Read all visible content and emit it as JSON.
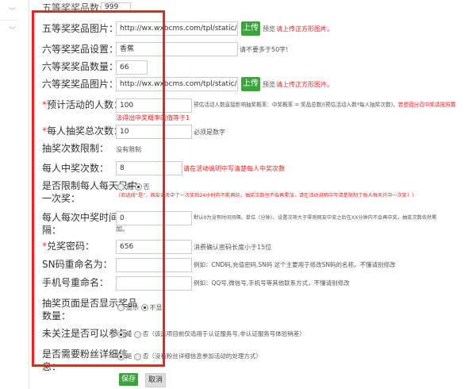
{
  "sidebar": {
    "items": [
      "chevron-down",
      "chevron-down"
    ]
  },
  "form": {
    "r0": {
      "label": "五等奖奖品数量：",
      "value": "999"
    },
    "r1": {
      "label": "五等奖奖品图片：",
      "value": "http://wx.wxbcms.com/tpl/static/attachment",
      "upload": "上传",
      "preview": "预览",
      "note": "请上传正方形图片。"
    },
    "r2": {
      "label": "六等奖奖品设置：",
      "value": "香蕉",
      "hint": "请不要多于50字!"
    },
    "r3": {
      "label": "六等奖奖品数量：",
      "value": "66"
    },
    "r4": {
      "label": "六等奖奖品图片：",
      "value": "http://wx.wxbcms.com/tpl/static/attachment",
      "upload": "上传",
      "preview": "预览",
      "note": "请上传正方形图片。"
    },
    "r5": {
      "req": "*",
      "label": "预计活动的人数：",
      "value": "100",
      "hint": "预估活动人数直接影响抽奖概率：中奖概率 = 奖品总数/(预估活动人数*每人抽奖次数)，",
      "note1": "若想百分百中奖请按照算",
      "note2": "法得出中奖概率的值等于1"
    },
    "r6": {
      "req": "*",
      "label": "每人抽奖总次数：",
      "value": "10",
      "hint": "必须是数字"
    },
    "r7": {
      "label": "抽奖次数限制：",
      "value": "没有限制"
    },
    "r8": {
      "label": "每人中奖次数：",
      "value": "8",
      "note": "请在活动说明中写清楚每人中奖次数"
    },
    "r9": {
      "label1": "是否限制每人每天只中",
      "label2": "一次奖：",
      "opt_yes": "是",
      "opt_no": "否",
      "note": "（若选择“是”，网友当天中了一次奖后24小时内不能再玩，抽奖次数也不会再累加，请在活动说明中写清楚限制了每人每天只中一次奖！）"
    },
    "r10": {
      "label1": "每人每次中奖时间间",
      "label2": "隔：",
      "value": "0",
      "hint1": "默认0为没有时间间隔。单位（分钟）。设置次项大于零则网友中奖之后在XX分钟内不会再中奖，抽奖次数依然累",
      "hint2": "加。"
    },
    "r11": {
      "req": "*",
      "label": "兑奖密码：",
      "value": "656",
      "hint": "消费确认密码长度小于15位"
    },
    "r12": {
      "label": "SN码重命名为：",
      "value": "",
      "hint": "例如：CND码,充值密码,SN码 这个主要用于修改SN码的名称，不懂请别修改"
    },
    "r13": {
      "label": "手机号重命名：",
      "value": "",
      "hint": "例如：QQ号,微信号,手机号等其他联系方式，不懂请别修改"
    },
    "r14": {
      "label1": "抽奖页面是否显示奖品",
      "label2": "数量：",
      "opt_show": "显示",
      "opt_hide": "不显"
    },
    "r15": {
      "label": "未关注是否可以参与：",
      "opt_yes": "是",
      "opt_no": "否",
      "note": "（该选项目前仅适用于认证服务号,非认证服务号体验稍差）"
    },
    "r16": {
      "label1": "是否需要粉丝详细信",
      "label2": "息：",
      "opt_yes": "是",
      "opt_no": "否",
      "note": "（没有粉丝详细信息参加活动的处理方式）"
    }
  },
  "actions": {
    "save": "保存",
    "cancel": "取消"
  },
  "colors": {
    "accent_green": "#3aa63a",
    "highlight_red": "#f22222"
  }
}
